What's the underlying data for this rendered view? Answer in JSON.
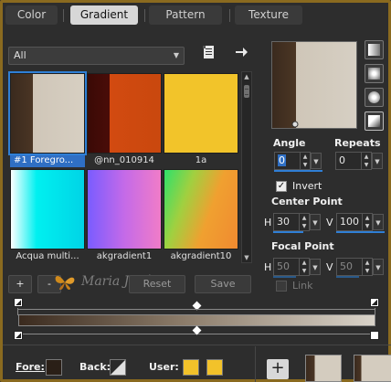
{
  "tabs": [
    {
      "label": "Color",
      "active": false
    },
    {
      "label": "Gradient",
      "active": true
    },
    {
      "label": "Pattern",
      "active": false
    },
    {
      "label": "Texture",
      "active": false
    }
  ],
  "library": {
    "category": "All",
    "items": [
      {
        "caption": "#1 Foregro...",
        "selected": true
      },
      {
        "caption": "@nn_010914",
        "selected": false
      },
      {
        "caption": "1a",
        "selected": false
      },
      {
        "caption": "Acqua multi...",
        "selected": false
      },
      {
        "caption": "akgradient1",
        "selected": false
      },
      {
        "caption": "akgradient10",
        "selected": false
      }
    ]
  },
  "toolbar": {
    "add_label": "+",
    "remove_label": "-",
    "reset_label": "Reset",
    "save_label": "Save",
    "watermark": "Maria José"
  },
  "settings": {
    "angle_label": "Angle",
    "angle_value": "0",
    "repeats_label": "Repeats",
    "repeats_value": "0",
    "invert_label": "Invert",
    "invert_checked": true,
    "center_point_label": "Center Point",
    "center_h_label": "H",
    "center_h_value": "30",
    "center_v_label": "V",
    "center_v_value": "100",
    "focal_point_label": "Focal Point",
    "focal_h_label": "H",
    "focal_h_value": "50",
    "focal_v_label": "V",
    "focal_v_value": "50",
    "link_label": "Link",
    "link_checked": false
  },
  "bottom": {
    "fore_label": "Fore:",
    "back_label": "Back:",
    "user_label": "User:",
    "fore_color": "#2a1f17",
    "user_color_1": "#f2c22a",
    "user_color_2": "#f2c22a"
  },
  "colors": {
    "accent": "#2f7fd6",
    "frame": "#8a6a1f",
    "gradient_start": "#3a2a1e",
    "gradient_end": "#d9d3c9"
  }
}
